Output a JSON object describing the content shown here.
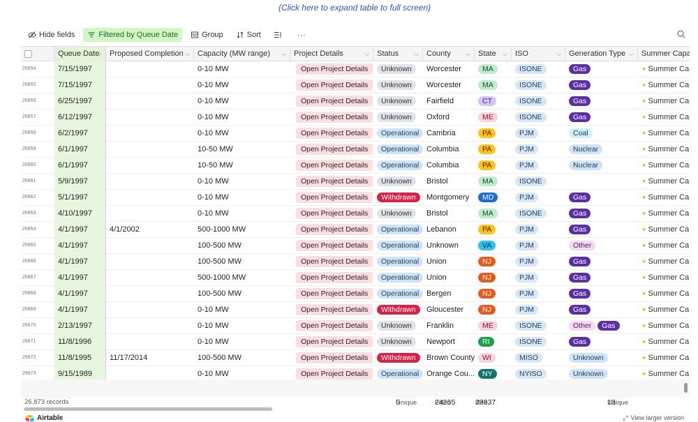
{
  "expand_link": "(Click here to expand table to full screen)",
  "toolbar": {
    "hide_fields": "Hide fields",
    "filter": "Filtered by Queue Date",
    "group": "Group",
    "sort": "Sort"
  },
  "columns": [
    "Queue Date",
    "Proposed Completion",
    "Capacity (MW range)",
    "Project Details",
    "Status",
    "County",
    "State",
    "ISO",
    "Generation Type",
    "Summer Capaci"
  ],
  "details_label": "Open Project Details",
  "summer_label": "Summer Cap",
  "rows": [
    {
      "id": "26854",
      "date": "7/15/1997",
      "completion": "",
      "capacity": "0-10 MW",
      "status": "Unknown",
      "county": "Worcester",
      "state": "MA",
      "iso": "ISONE",
      "gen": [
        "Gas"
      ]
    },
    {
      "id": "26855",
      "date": "7/15/1997",
      "completion": "",
      "capacity": "0-10 MW",
      "status": "Unknown",
      "county": "Worcester",
      "state": "MA",
      "iso": "ISONE",
      "gen": [
        "Gas"
      ]
    },
    {
      "id": "26856",
      "date": "6/25/1997",
      "completion": "",
      "capacity": "0-10 MW",
      "status": "Unknown",
      "county": "Fairfield",
      "state": "CT",
      "iso": "ISONE",
      "gen": [
        "Gas"
      ]
    },
    {
      "id": "26857",
      "date": "6/12/1997",
      "completion": "",
      "capacity": "0-10 MW",
      "status": "Unknown",
      "county": "Oxford",
      "state": "ME",
      "iso": "ISONE",
      "gen": [
        "Gas"
      ]
    },
    {
      "id": "26858",
      "date": "6/2/1997",
      "completion": "",
      "capacity": "0-10 MW",
      "status": "Operational",
      "county": "Cambria",
      "state": "PA",
      "iso": "PJM",
      "gen": [
        "Coal"
      ]
    },
    {
      "id": "26859",
      "date": "6/1/1997",
      "completion": "",
      "capacity": "10-50 MW",
      "status": "Operational",
      "county": "Columbia",
      "state": "PA",
      "iso": "PJM",
      "gen": [
        "Nuclear"
      ]
    },
    {
      "id": "26860",
      "date": "6/1/1997",
      "completion": "",
      "capacity": "10-50 MW",
      "status": "Operational",
      "county": "Columbia",
      "state": "PA",
      "iso": "PJM",
      "gen": [
        "Nuclear"
      ]
    },
    {
      "id": "26861",
      "date": "5/9/1997",
      "completion": "",
      "capacity": "0-10 MW",
      "status": "Unknown",
      "county": "Bristol",
      "state": "MA",
      "iso": "ISONE",
      "gen": []
    },
    {
      "id": "26862",
      "date": "5/1/1997",
      "completion": "",
      "capacity": "0-10 MW",
      "status": "Withdrawn",
      "county": "Montgomery",
      "state": "MD",
      "iso": "PJM",
      "gen": [
        "Gas"
      ]
    },
    {
      "id": "26863",
      "date": "4/10/1997",
      "completion": "",
      "capacity": "0-10 MW",
      "status": "Unknown",
      "county": "Bristol",
      "state": "MA",
      "iso": "ISONE",
      "gen": [
        "Gas"
      ]
    },
    {
      "id": "26864",
      "date": "4/1/1997",
      "completion": "4/1/2002",
      "capacity": "500-1000 MW",
      "status": "Operational",
      "county": "Lebanon",
      "state": "PA",
      "iso": "PJM",
      "gen": [
        "Gas"
      ]
    },
    {
      "id": "26865",
      "date": "4/1/1997",
      "completion": "",
      "capacity": "100-500 MW",
      "status": "Operational",
      "county": "Unknown",
      "state": "VA",
      "iso": "PJM",
      "gen": [
        "Other"
      ]
    },
    {
      "id": "26866",
      "date": "4/1/1997",
      "completion": "",
      "capacity": "100-500 MW",
      "status": "Operational",
      "county": "Union",
      "state": "NJ",
      "iso": "PJM",
      "gen": [
        "Gas"
      ]
    },
    {
      "id": "26867",
      "date": "4/1/1997",
      "completion": "",
      "capacity": "500-1000 MW",
      "status": "Operational",
      "county": "Union",
      "state": "NJ",
      "iso": "PJM",
      "gen": [
        "Gas"
      ]
    },
    {
      "id": "26868",
      "date": "4/1/1997",
      "completion": "",
      "capacity": "100-500 MW",
      "status": "Operational",
      "county": "Bergen",
      "state": "NJ",
      "iso": "PJM",
      "gen": [
        "Gas"
      ]
    },
    {
      "id": "26869",
      "date": "4/1/1997",
      "completion": "",
      "capacity": "0-10 MW",
      "status": "Withdrawn",
      "county": "Gloucester",
      "state": "NJ",
      "iso": "PJM",
      "gen": [
        "Gas"
      ]
    },
    {
      "id": "26870",
      "date": "2/13/1997",
      "completion": "",
      "capacity": "0-10 MW",
      "status": "Unknown",
      "county": "Franklin",
      "state": "ME",
      "iso": "ISONE",
      "gen": [
        "Other",
        "Gas"
      ]
    },
    {
      "id": "26871",
      "date": "11/8/1996",
      "completion": "",
      "capacity": "0-10 MW",
      "status": "Unknown",
      "county": "Newport",
      "state": "RI",
      "iso": "ISONE",
      "gen": [
        "Gas"
      ]
    },
    {
      "id": "26872",
      "date": "11/8/1995",
      "completion": "11/17/2014",
      "capacity": "100-500 MW",
      "status": "Withdrawn",
      "county": "Brown County",
      "state": "WI",
      "iso": "MISO",
      "gen": [
        "Unknown"
      ]
    },
    {
      "id": "26873",
      "date": "9/15/1989",
      "completion": "",
      "capacity": "0-10 MW",
      "status": "Operational",
      "county": "Orange Cou...",
      "state": "NY",
      "iso": "NYISO",
      "gen": [
        "Unknown"
      ]
    }
  ],
  "footer": {
    "records": "26,873 records",
    "unique_a_label": "Unique",
    "unique_a_value": "5",
    "filled_label": "Filled",
    "filled_value": "24265",
    "filled2_label": "illed",
    "filled2_value": "23937",
    "unique_b_label": "Unique",
    "unique_b_value": "13"
  },
  "brand": "Airtable",
  "view_larger": "View larger version",
  "colors": {
    "status": {
      "Unknown": [
        "#e0e3e8",
        "#333333"
      ],
      "Operational": [
        "#d0e4f7",
        "#1f3d5c"
      ],
      "Withdrawn": [
        "#d62246",
        "#ffffff"
      ]
    },
    "state": {
      "MA": [
        "#bfeccc",
        "#1d4d2b"
      ],
      "CT": [
        "#d6c6f5",
        "#3b2a66"
      ],
      "ME": [
        "#fbd1dc",
        "#6b1c33"
      ],
      "PA": [
        "#ffc21a",
        "#3d2b00"
      ],
      "MD": [
        "#1f6bd6",
        "#ffffff"
      ],
      "VA": [
        "#2cc3f0",
        "#0a3140"
      ],
      "NJ": [
        "#e65a1e",
        "#ffffff"
      ],
      "RI": [
        "#16a34a",
        "#ffffff"
      ],
      "WI": [
        "#fbd1dc",
        "#6b1c33"
      ],
      "NY": [
        "#10766d",
        "#ffffff"
      ]
    },
    "iso": [
      "#d9e6f6",
      "#1f3d5c"
    ],
    "gen": {
      "Gas": [
        "#5b2ea6",
        "#ffffff"
      ],
      "Coal": [
        "#cfeefa",
        "#123b4a"
      ],
      "Nuclear": [
        "#d0e4f7",
        "#1f3d5c"
      ],
      "Other": [
        "#f6d7f6",
        "#5a2157"
      ],
      "Unknown": [
        "#d0e4f7",
        "#1f3d5c"
      ]
    }
  }
}
